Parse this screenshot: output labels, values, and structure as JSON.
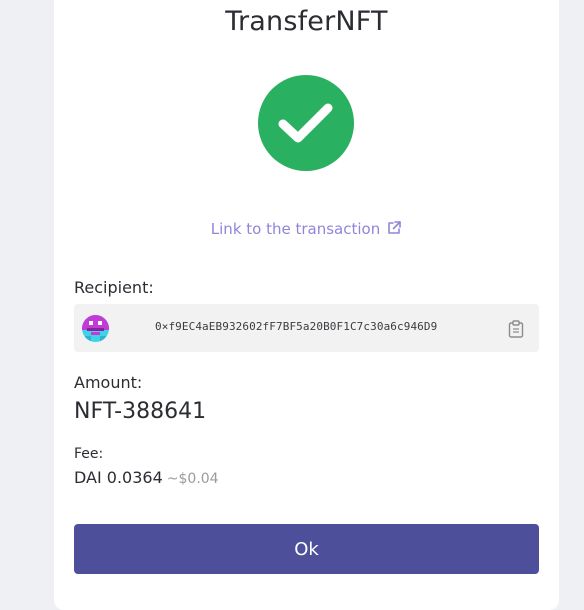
{
  "dialog": {
    "title": "TransferNFT",
    "transaction_link": "Link to the transaction",
    "ok_label": "Ok"
  },
  "recipient": {
    "label": "Recipient:",
    "address": "0×f9EC4aEB932602fF7BF5a20B0F1C7c30a6c946D9"
  },
  "amount": {
    "label": "Amount:",
    "value": "NFT-388641"
  },
  "fee": {
    "label": "Fee:",
    "value": "DAI 0.0364",
    "usd": "~$0.04"
  },
  "icons": {
    "status": "check-icon",
    "link": "external-link-icon",
    "copy": "clipboard-icon",
    "avatar": "identicon-avatar"
  },
  "colors": {
    "success": "#29b060",
    "link": "#8f86da",
    "primary_button": "#4e4f9a",
    "muted": "#9a9ba0"
  }
}
